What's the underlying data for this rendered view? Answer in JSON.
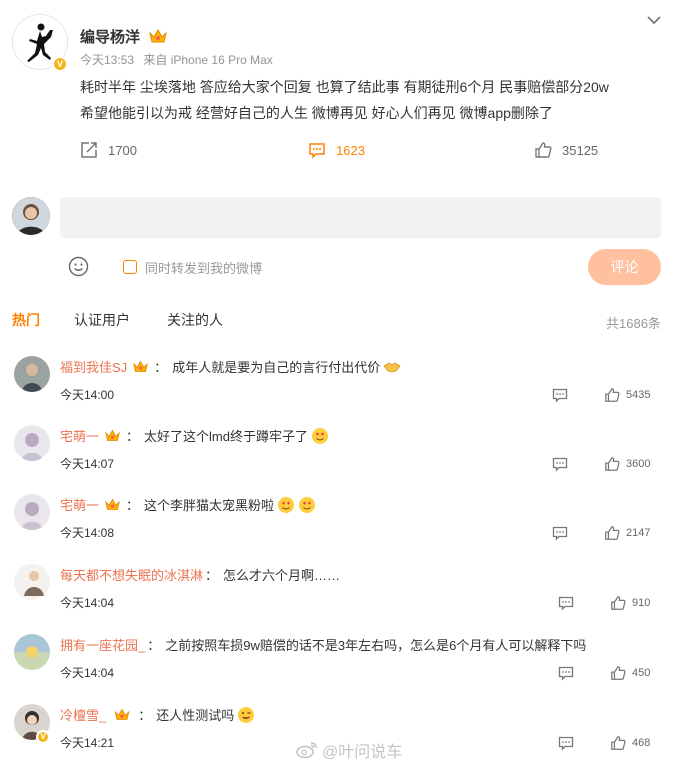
{
  "post": {
    "author": "编导杨洋",
    "verified_icon": "v-badge-icon",
    "time": "今天13:53",
    "source": "来自 iPhone 16 Pro Max",
    "text_line1": "耗时半年 尘埃落地 答应给大家个回复 也算了结此事 有期徒刑6个月 民事赔偿部分20w",
    "text_line2": "希望他能引以为戒 经营好自己的人生 微博再见 好心人们再见 微博app删除了",
    "reposts": "1700",
    "comments": "1623",
    "likes": "35125"
  },
  "composer": {
    "repost_label": "同时转发到我的微博",
    "submit_label": "评论"
  },
  "tabs": {
    "hot": "热门",
    "verified": "认证用户",
    "following": "关注的人",
    "total": "共1686条"
  },
  "comments": [
    {
      "user": "福到我佳SJ",
      "sep": "：",
      "text": "成年人就是要为自己的言行付出代价",
      "emoji": [
        "handshake"
      ],
      "time": "今天14:00",
      "likes": "5435"
    },
    {
      "user": "宅萌一",
      "sep": "：",
      "text": "太好了这个lmd终于蹲牢子了",
      "emoji": [
        "heart-eyes"
      ],
      "time": "今天14:07",
      "likes": "3600"
    },
    {
      "user": "宅萌一",
      "sep": "：",
      "text": "这个李胖猫太宠黑粉啦",
      "emoji": [
        "heart-eyes",
        "heart-eyes"
      ],
      "time": "今天14:08",
      "likes": "2147"
    },
    {
      "user": "每天都不想失眠的冰淇淋",
      "sep": "：",
      "text": "怎么才六个月啊……",
      "emoji": [],
      "time": "今天14:04",
      "likes": "910"
    },
    {
      "user": "拥有一座花园_",
      "sep": "：",
      "text": "之前按照车损9w赔偿的话不是3年左右吗，怎么是6个月有人可以解释下吗",
      "emoji": [],
      "time": "今天14:04",
      "likes": "450"
    },
    {
      "user": "冷檀雪_",
      "sep": "：",
      "text": "还人性测试吗",
      "emoji": [
        "wink-tongue"
      ],
      "time": "今天14:21",
      "likes": "468"
    }
  ],
  "watermark": "@叶问说车",
  "colors": {
    "accent": "#ff8200",
    "username": "#eb7350",
    "submit": "#ffc09f"
  }
}
